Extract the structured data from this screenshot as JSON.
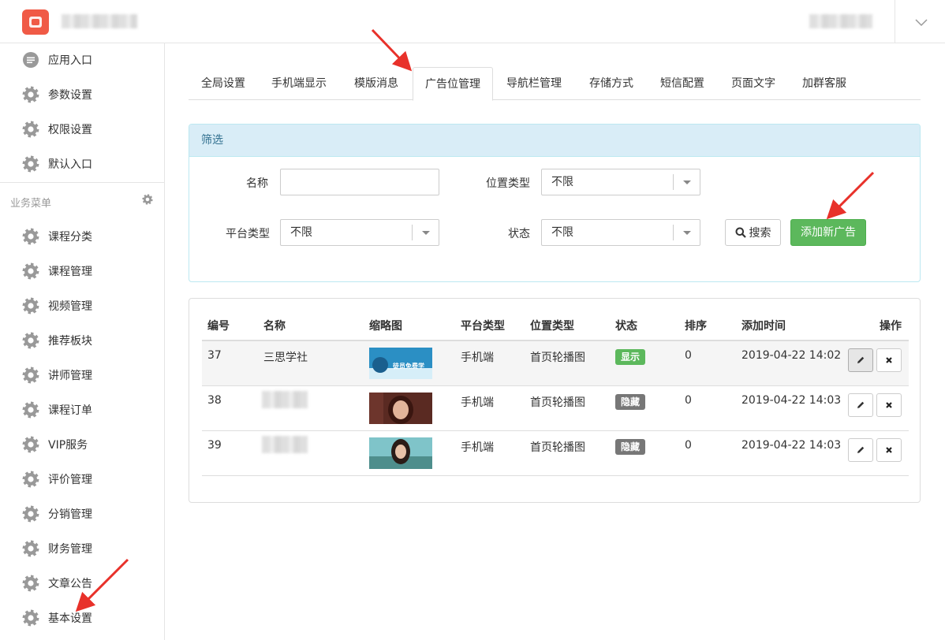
{
  "sidebar": {
    "top_items": [
      {
        "label": "应用入口",
        "icon": "chat-icon"
      },
      {
        "label": "参数设置",
        "icon": "gear-icon"
      },
      {
        "label": "权限设置",
        "icon": "gear-icon"
      },
      {
        "label": "默认入口",
        "icon": "gear-icon"
      }
    ],
    "section_title": "业务菜单",
    "items": [
      {
        "label": "课程分类"
      },
      {
        "label": "课程管理"
      },
      {
        "label": "视频管理"
      },
      {
        "label": "推荐板块"
      },
      {
        "label": "讲师管理"
      },
      {
        "label": "课程订单"
      },
      {
        "label": "VIP服务"
      },
      {
        "label": "评价管理"
      },
      {
        "label": "分销管理"
      },
      {
        "label": "财务管理"
      },
      {
        "label": "文章公告"
      },
      {
        "label": "基本设置"
      }
    ]
  },
  "tabs": [
    "全局设置",
    "手机端显示",
    "模版消息",
    "广告位管理",
    "导航栏管理",
    "存储方式",
    "短信配置",
    "页面文字",
    "加群客服"
  ],
  "active_tab": "广告位管理",
  "filter": {
    "title": "筛选",
    "name_label": "名称",
    "name_value": "",
    "position_label": "位置类型",
    "position_value": "不限",
    "platform_label": "平台类型",
    "platform_value": "不限",
    "status_label": "状态",
    "status_value": "不限",
    "search_label": "搜索",
    "add_label": "添加新广告"
  },
  "table": {
    "headers": [
      "编号",
      "名称",
      "缩略图",
      "平台类型",
      "位置类型",
      "状态",
      "排序",
      "添加时间",
      "操作"
    ],
    "rows": [
      {
        "id": "37",
        "name": "三思学社",
        "platform": "手机端",
        "position": "首页轮播图",
        "status": "显示",
        "sort": "0",
        "time": "2019-04-22 14:02",
        "thumb_text": "徒员免费学"
      },
      {
        "id": "38",
        "name": "",
        "platform": "手机端",
        "position": "首页轮播图",
        "status": "隐藏",
        "sort": "0",
        "time": "2019-04-22 14:03"
      },
      {
        "id": "39",
        "name": "",
        "platform": "手机端",
        "position": "首页轮播图",
        "status": "隐藏",
        "sort": "0",
        "time": "2019-04-22 14:03"
      }
    ]
  },
  "colors": {
    "accent_green": "#5cb85c",
    "panel_blue": "#d9edf7",
    "arrow_red": "#e8312a",
    "logo_red": "#f05a46"
  }
}
